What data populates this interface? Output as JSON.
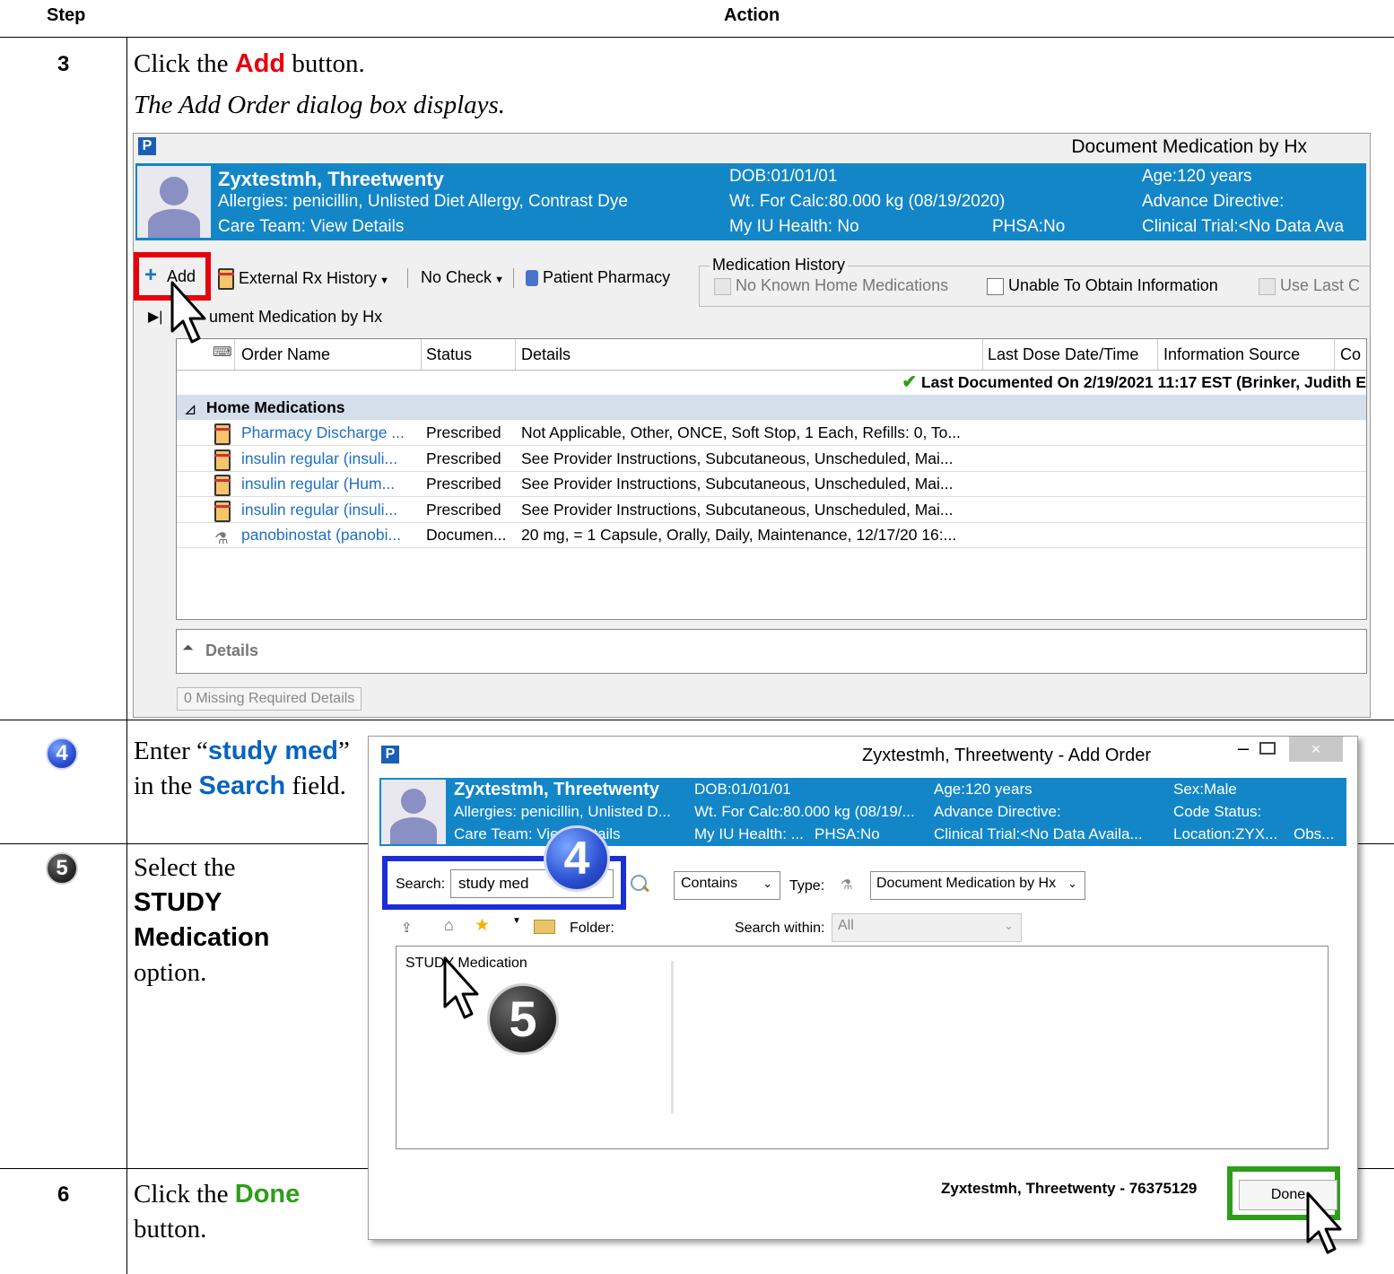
{
  "table": {
    "header_step": "Step",
    "header_action": "Action"
  },
  "steps": [
    {
      "number": "3",
      "text_before": "Click the ",
      "highlight": "Add",
      "text_after": " button.",
      "result": "The Add Order dialog box displays."
    },
    {
      "number": "4",
      "text_1": "Enter “",
      "highlight_1": "study med",
      "text_2": "” in the ",
      "highlight_2": "Search",
      "text_3": " field."
    },
    {
      "number": "5",
      "text_1": "Select the ",
      "highlight_1": "STUDY Medication",
      "text_2": " option."
    },
    {
      "number": "6",
      "text_1": "Click the ",
      "highlight_1": "Done",
      "text_2": " button."
    }
  ],
  "screen1": {
    "window_title": "Document Medication by Hx",
    "patient": {
      "name": "Zyxtestmh, Threetwenty",
      "allergies": "Allergies: penicillin, Unlisted Diet Allergy, Contrast Dye",
      "care_team": "Care Team: View Details",
      "dob": "DOB:01/01/01",
      "weight": "Wt. For Calc:80.000 kg (08/19/2020)",
      "my_iu_health": "My IU Health: No",
      "phsa": "PHSA:No",
      "age": "Age:120 years",
      "advance_directive": "Advance Directive:",
      "clinical_trial": "Clinical Trial:<No Data Ava"
    },
    "toolbar": {
      "add": "Add",
      "external_rx": "External Rx History",
      "no_check": "No Check",
      "patient_pharmacy": "Patient Pharmacy"
    },
    "med_history": {
      "title": "Medication History",
      "no_known": "No Known Home Medications",
      "unable": "Unable To Obtain Information",
      "use_last": "Use Last C"
    },
    "section_title": "ument Medication by Hx",
    "columns": {
      "order_name": "Order Name",
      "status": "Status",
      "details": "Details",
      "last_dose": "Last Dose Date/Time",
      "info_source": "Information Source",
      "co": "Co"
    },
    "last_documented": "Last Documented On 2/19/2021 11:17 EST (Brinker, Judith E",
    "group": "Home Medications",
    "rows": [
      {
        "name": "Pharmacy Discharge ...",
        "status": "Prescribed",
        "details": "Not Applicable, Other, ONCE, Soft Stop, 1 Each, Refills: 0, To..."
      },
      {
        "name": "insulin regular (insuli...",
        "status": "Prescribed",
        "details": "See Provider Instructions, Subcutaneous, Unscheduled, Mai..."
      },
      {
        "name": "insulin regular (Hum...",
        "status": "Prescribed",
        "details": "See Provider Instructions, Subcutaneous, Unscheduled, Mai..."
      },
      {
        "name": "insulin regular (insuli...",
        "status": "Prescribed",
        "details": "See Provider Instructions, Subcutaneous, Unscheduled, Mai..."
      },
      {
        "name": "panobinostat (panobi...",
        "status": "Documen...",
        "details": "20 mg, = 1 Capsule, Orally, Daily, Maintenance, 12/17/20 16:..."
      }
    ],
    "details_label": "Details",
    "missing_details": "0 Missing Required Details"
  },
  "screen2": {
    "window_title": "Zyxtestmh, Threetwenty - Add Order",
    "close_glyph": "×",
    "patient": {
      "name": "Zyxtestmh, Threetwenty",
      "allergies": "Allergies: penicillin, Unlisted D...",
      "care_team": "Care Team: View Details",
      "dob": "DOB:01/01/01",
      "weight": "Wt. For Calc:80.000 kg (08/19/...",
      "my_iu_health": "My IU Health: ...",
      "phsa": "PHSA:No",
      "age": "Age:120 years",
      "advance_directive": "Advance Directive:",
      "clinical_trial": "Clinical Trial:<No Data Availa...",
      "sex": "Sex:Male",
      "code_status": "Code Status:",
      "location": "Location:ZYX...",
      "obs": "Obs..."
    },
    "search_label": "Search:",
    "search_value": "study med",
    "contains": "Contains",
    "type_label": "Type:",
    "type_value": "Document Medication by Hx",
    "folder_label": "Folder:",
    "search_within_label": "Search within:",
    "search_within_value": "All",
    "result_item": "STUDY Medication",
    "footer_patient": "Zyxtestmh, Threetwenty - 76375129",
    "done": "Done"
  },
  "callouts": {
    "step4": "4",
    "step5": "5"
  },
  "colors": {
    "red": "#e8000d",
    "blue": "#0563c1",
    "green": "#2e9d1a",
    "patient_bar": "#1386c7"
  }
}
